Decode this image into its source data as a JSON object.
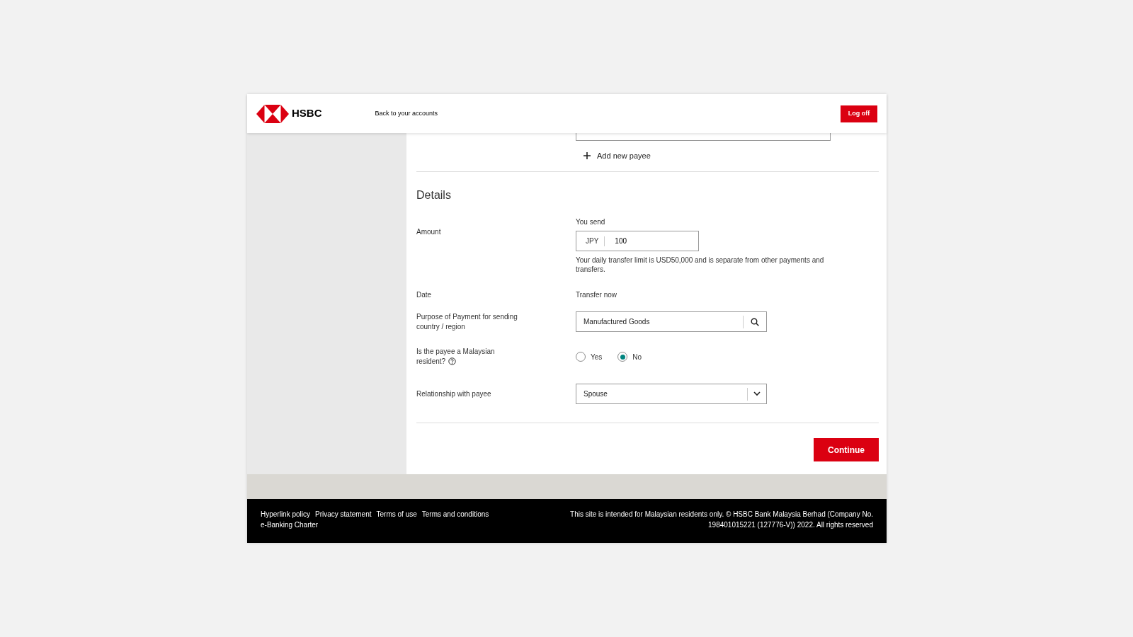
{
  "header": {
    "logo_text": "HSBC",
    "back_link": "Back to your accounts",
    "logoff_button": "Log off"
  },
  "payee": {
    "add_payee": "Add new payee"
  },
  "details": {
    "title": "Details",
    "amount": {
      "label": "Amount",
      "caption": "You send",
      "currency": "JPY",
      "value": "100",
      "note": "Your daily transfer limit is USD50,000 and is separate from other payments and transfers."
    },
    "date": {
      "label": "Date",
      "value": "Transfer now"
    },
    "purpose": {
      "label": "Purpose of Payment for sending country / region",
      "value": "Manufactured Goods"
    },
    "resident": {
      "label": "Is the payee a Malaysian resident?",
      "options": [
        {
          "label": "Yes",
          "selected": false
        },
        {
          "label": "No",
          "selected": true
        }
      ]
    },
    "relationship": {
      "label": "Relationship with payee",
      "value": "Spouse"
    },
    "continue_button": "Continue"
  },
  "footer": {
    "links": [
      "Hyperlink policy",
      "Privacy statement",
      "Terms of use",
      "Terms and conditions",
      "e-Banking Charter"
    ],
    "notice": "This site is intended for Malaysian residents only. © HSBC Bank Malaysia Berhad (Company No. 198401015221 (127776-V)) 2022. All rights reserved"
  }
}
